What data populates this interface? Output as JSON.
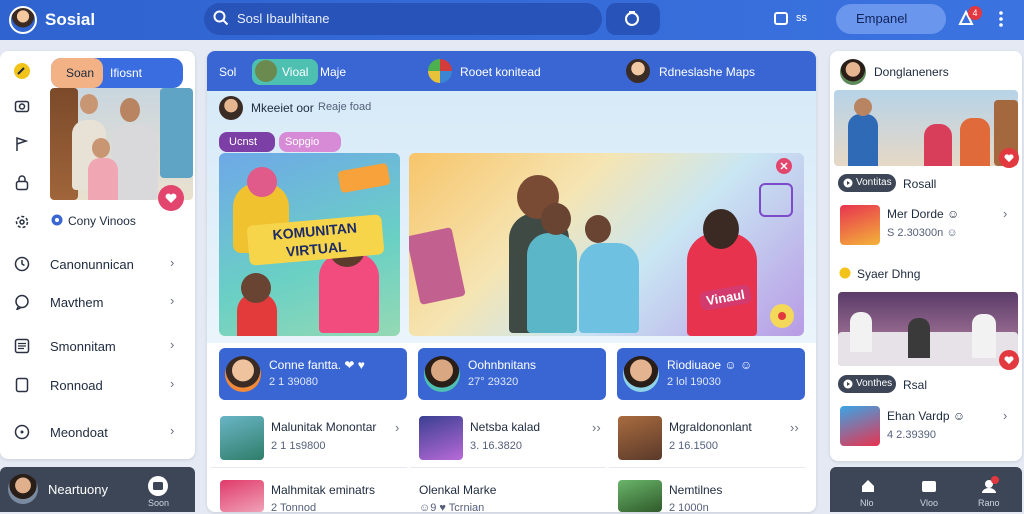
{
  "app": {
    "title": "Sosial"
  },
  "header": {
    "search_placeholder": "Sosl Ibaulhitane",
    "camera_count": "ss",
    "button_label": "Empanel",
    "notification_count": "4"
  },
  "left_sidebar": {
    "tabs": [
      "Soan",
      "Ifiosnt"
    ],
    "items": [
      {
        "label": "Cony Vinoos",
        "icon": "pin-icon"
      },
      {
        "label": "Canonunnican",
        "icon": "clock-icon"
      },
      {
        "label": "Mavthem",
        "icon": "chat-icon"
      },
      {
        "label": "Smonnitam",
        "icon": "list-icon"
      },
      {
        "label": "Ronnoad",
        "icon": "bookmark-icon"
      },
      {
        "label": "Meondoat",
        "icon": "circle-icon"
      }
    ],
    "rail_icons": [
      "compass-icon",
      "camera-icon",
      "flag-icon",
      "lock-icon",
      "gear-icon"
    ],
    "profile_name": "Neartuony",
    "profile_action": "Soon"
  },
  "main": {
    "tabs": [
      {
        "label": "Sol"
      },
      {
        "label": "Vioal"
      },
      {
        "label": "Maje"
      },
      {
        "label": "Rooet konitead"
      },
      {
        "label": "Rdneslashe Maps"
      }
    ],
    "post_author": "Mkeeiet oor",
    "post_action": "Reaje foad",
    "chips": [
      "Ucnst",
      "Sopgio"
    ],
    "banner_title": "KOMUNITAN VIRTUAL",
    "banner_sticker": "Vinaul",
    "cards": [
      {
        "title": "Conne fantta. ❤ ♥",
        "meta": "2 1 39080"
      },
      {
        "title": "Oohnbnitans",
        "meta": "27° 29320"
      },
      {
        "title": "Riodiuaoe ☺ ☺",
        "meta": "2 lol 19030"
      }
    ],
    "list": [
      {
        "title": "Malunitak Monontar",
        "meta": "2 1 1s9800"
      },
      {
        "title": "Netsba kalad",
        "meta": "3. 16.3820"
      },
      {
        "title": "Mgraldononlant",
        "meta": "2 16.1500"
      },
      {
        "title": "Malhmitak eminatrs",
        "meta": "2 Tonnod"
      },
      {
        "title": "Olenkal Marke",
        "meta": "☺9 ♥ Tcrnian"
      },
      {
        "title": "Nemtilnes",
        "meta": "2 1000n"
      }
    ]
  },
  "right_sidebar": {
    "header": "Donglaneners",
    "photo_badge": "Vontitas",
    "photo_caption": "Rosall",
    "event1_title": "Mer Dorde ☺",
    "event1_meta": "S 2.30300n ☺",
    "section_title": "Syaer Dhng",
    "photo2_badge": "Vonthes",
    "photo2_caption": "Rsal",
    "event2_title": "Ehan Vardp ☺",
    "event2_meta": "4 2.39390",
    "nav": [
      "Nlo",
      "Vloo",
      "Rano"
    ]
  },
  "colors": {
    "brand": "#3366d6",
    "card_blue": "#3a66d4",
    "accent_red": "#e2383f",
    "panel_bg": "#ffffff"
  }
}
